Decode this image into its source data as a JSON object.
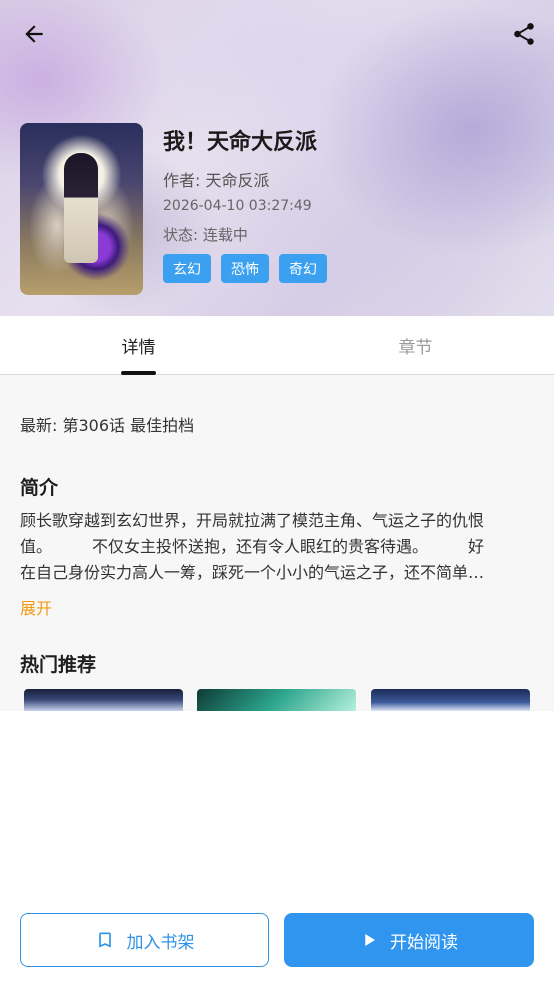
{
  "header": {
    "back_icon": "arrow-left-icon",
    "share_icon": "share-icon"
  },
  "book": {
    "title": "我！天命大反派",
    "author": "作者: 天命反派",
    "updated": "2026-04-10 03:27:49",
    "status": "状态: 连载中",
    "tags": [
      "玄幻",
      "恐怖",
      "奇幻"
    ]
  },
  "tabs": [
    {
      "label": "详情",
      "active": true
    },
    {
      "label": "章节",
      "active": false
    }
  ],
  "details": {
    "latest": "最新: 第306话 最佳拍档",
    "intro_title": "简介",
    "intro_lines": [
      "顾长歌穿越到玄幻世界，开局就拉满了模范主角、气运之子的仇恨",
      "值。　　　不仅女主投怀送抱，还有令人眼红的贵客待遇。　　　好",
      "在自己身份实力高人一筹，踩死一个小小的气运之子，还不简单…"
    ],
    "expand_label": "展开",
    "hot_title": "热门推荐"
  },
  "actions": {
    "shelf_label": "加入书架",
    "shelf_icon": "bookmark-icon",
    "read_label": "开始阅读",
    "read_icon": "play-icon"
  },
  "colors": {
    "accent": "#2f95ef",
    "tag": "#3aa0ef",
    "expand": "#f29a16"
  }
}
